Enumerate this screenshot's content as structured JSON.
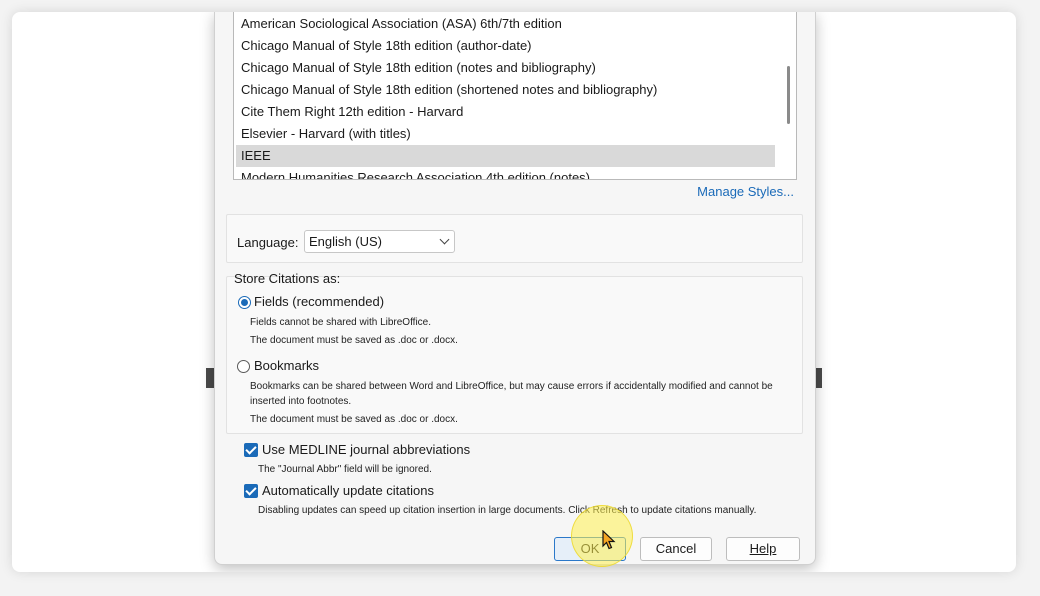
{
  "citation_styles": {
    "items": [
      "American Sociological Association (ASA) 6th/7th edition",
      "Chicago Manual of Style 18th edition (author-date)",
      "Chicago Manual of Style 18th edition (notes and bibliography)",
      "Chicago Manual of Style 18th edition (shortened notes and bibliography)",
      "Cite Them Right 12th edition - Harvard",
      "Elsevier - Harvard (with titles)",
      "IEEE",
      "Modern Humanities Research Association 4th edition (notes)"
    ],
    "selected": "IEEE",
    "manage_link": "Manage Styles..."
  },
  "language": {
    "label": "Language:",
    "value": "English (US)"
  },
  "store_citations": {
    "title": "Store Citations as:",
    "fields": {
      "label": "Fields (recommended)",
      "selected": true,
      "note1": "Fields cannot be shared with LibreOffice.",
      "note2": "The document must be saved as .doc or .docx."
    },
    "bookmarks": {
      "label": "Bookmarks",
      "selected": false,
      "note1": "Bookmarks can be shared between Word and LibreOffice, but may cause errors if accidentally modified and cannot be",
      "note1b": "inserted into footnotes.",
      "note2": "The document must be saved as .doc or .docx."
    }
  },
  "options": {
    "medline": {
      "label": "Use MEDLINE journal abbreviations",
      "checked": true,
      "note": "The \"Journal Abbr\" field will be ignored."
    },
    "auto_update": {
      "label": "Automatically update citations",
      "checked": true,
      "note": "Disabling updates can speed up citation insertion in large documents. Click Refresh to update citations manually."
    }
  },
  "buttons": {
    "ok": "OK",
    "cancel": "Cancel",
    "help": "Help"
  },
  "colors": {
    "accent": "#1a6ab8",
    "selected_row": "#d9d9d9",
    "cursor_highlight": "#fff050"
  }
}
